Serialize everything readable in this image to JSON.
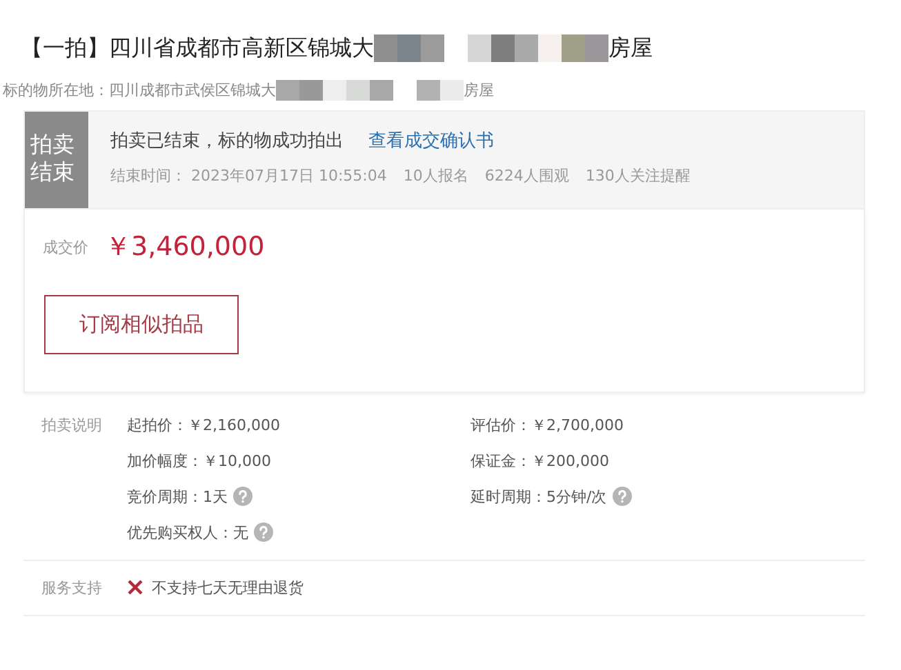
{
  "title": {
    "parts": [
      "【一拍】四川省成都市高新区锦城大",
      "房屋"
    ]
  },
  "location": {
    "label": "标的物所在地：",
    "parts": [
      "四川成都市武侯区锦城大",
      "房屋"
    ]
  },
  "status": {
    "badge": "拍卖结束",
    "message": "拍卖已结束，标的物成功拍出",
    "link": "查看成交确认书",
    "stats": [
      "结束时间： 2023年07月17日 10:55:04",
      "10人报名",
      "6224人围观",
      "130人关注提醒"
    ]
  },
  "price": {
    "label": "成交价",
    "value": "￥3,460,000"
  },
  "subscribe_button": "订阅相似拍品",
  "details": {
    "label": "拍卖说明",
    "items": [
      {
        "text": "起拍价：￥2,160,000",
        "help": false
      },
      {
        "text": "评估价：￥2,700,000",
        "help": false
      },
      {
        "text": "加价幅度：￥10,000",
        "help": false
      },
      {
        "text": "保证金：￥200,000",
        "help": false
      },
      {
        "text": "竞价周期：1天",
        "help": true
      },
      {
        "text": "延时周期：5分钟/次",
        "help": true
      },
      {
        "text": "优先购买权人：无",
        "help": true
      }
    ]
  },
  "service": {
    "label": "服务支持",
    "items": [
      {
        "text": "不支持七天无理由退货",
        "supported": false
      }
    ]
  }
}
